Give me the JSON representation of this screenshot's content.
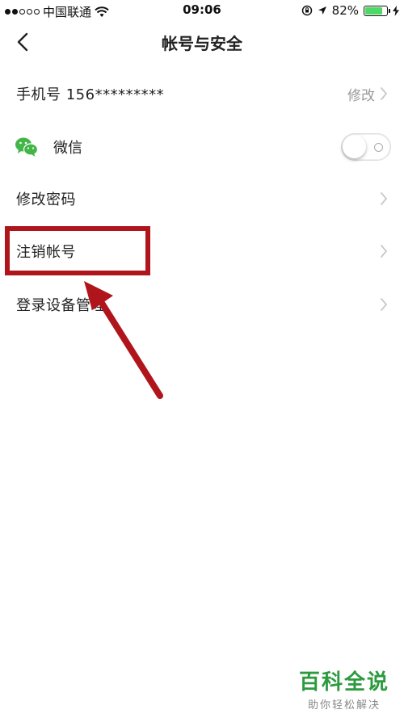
{
  "status_bar": {
    "carrier": "中国联通",
    "time": "09:06",
    "battery_percent": "82%",
    "battery_level": 0.82,
    "icons": [
      "signal-dots-icon",
      "wifi-icon",
      "orientation-lock-icon",
      "location-arrow-icon",
      "battery-icon",
      "charging-bolt-icon"
    ]
  },
  "nav": {
    "title": "帐号与安全",
    "back_icon": "chevron-left-icon"
  },
  "rows": {
    "phone": {
      "label": "手机号 156*********",
      "action": "修改"
    },
    "wechat": {
      "label": "微信",
      "toggle_on": false,
      "icon": "wechat-icon"
    },
    "change_password": {
      "label": "修改密码"
    },
    "deactivate": {
      "label": "注销帐号"
    },
    "devices": {
      "label": "登录设备管理"
    }
  },
  "annotation": {
    "highlight_color": "#b0151c",
    "highlighted_item": "注销帐号"
  },
  "watermark": {
    "main": "百科全说",
    "sub": "助你轻松解决",
    "color": "#2d9a3e"
  }
}
